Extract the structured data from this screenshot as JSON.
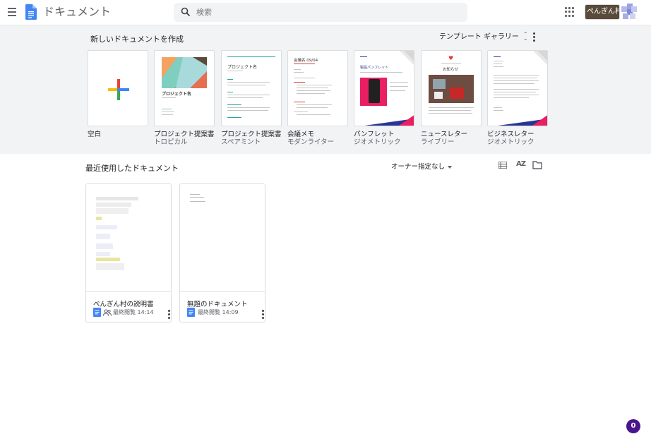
{
  "header": {
    "app_title": "ドキュメント",
    "search_placeholder": "検索",
    "account_label": "ぺんぎん村パ"
  },
  "templates": {
    "section_title": "新しいドキュメントを作成",
    "gallery_label": "テンプレート ギャラリー",
    "items": [
      {
        "name": "空白",
        "sub": ""
      },
      {
        "name": "プロジェクト提案書",
        "sub": "トロピカル",
        "thumb_title": "プロジェクト名"
      },
      {
        "name": "プロジェクト提案書",
        "sub": "スペアミント",
        "thumb_title": "プロジェクト名"
      },
      {
        "name": "会議メモ",
        "sub": "モダンライター",
        "thumb_title": "会議名 09/04"
      },
      {
        "name": "パンフレット",
        "sub": "ジオメトリック",
        "thumb_title": "製品パンフレット"
      },
      {
        "name": "ニュースレター",
        "sub": "ライブリー",
        "thumb_title": "お知らせ"
      },
      {
        "name": "ビジネスレター",
        "sub": "ジオメトリック"
      }
    ]
  },
  "recent": {
    "section_title": "最近使用したドキュメント",
    "owner_filter": "オーナー指定なし",
    "sort_label": "AZ",
    "documents": [
      {
        "name": "ぺんぎん村の説明書",
        "opened": "最終閲覧 14:14",
        "shared": true
      },
      {
        "name": "無題のドキュメント",
        "opened": "最終閲覧 14:09",
        "shared": false
      }
    ]
  },
  "badge": "0",
  "colors": {
    "docs_blue": "#4285f4",
    "band_bg": "#f1f3f4",
    "badge_purple": "#4a148c",
    "tropical_teal": "#7fcfc0",
    "geometric_magenta": "#e91e63"
  }
}
